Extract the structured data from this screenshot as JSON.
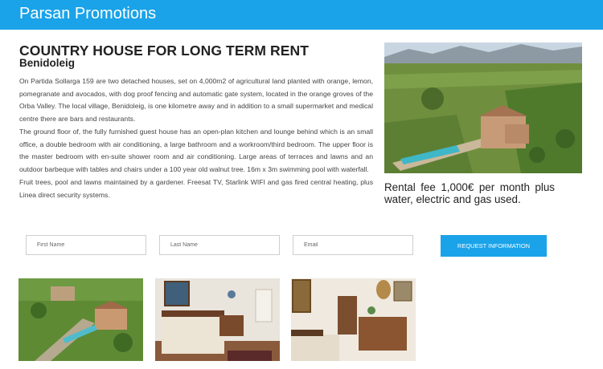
{
  "header": {
    "brand": "Parsan Promotions"
  },
  "listing": {
    "title": "COUNTRY HOUSE FOR LONG TERM RENT",
    "location": "Benidoleig",
    "paragraphs": [
      "On Partida Sollarga 159 are two detached houses, set on 4,000m2 of agricultural land planted with orange, lemon, pomegranate and avocados, with dog proof fencing and automatic gate system, located in the orange groves of the Orba Valley. The local village, Benidoleig, is one kilometre away and in addition to a small supermarket and medical centre there are bars and restaurants.",
      "The ground floor of, the fully furnished guest house has an open-plan kitchen and lounge behind which is an small office, a double bedroom with air conditioning, a large bathroom and a workroom/third bedroom. The upper floor is the master bedroom with en-suite shower room and air conditioning. Large areas of terraces and lawns and an outdoor barbeque with tables and chairs under a 100 year old walnut tree. 16m x 3m swimming pool with waterfall.",
      "Fruit trees, pool and lawns maintained by a gardener. Freesat TV, Starlink WIFI and gas fired central heating, plus Linea direct security systems."
    ],
    "rental": "Rental fee 1,000€ per month plus water, electric and gas used."
  },
  "form": {
    "first_name_placeholder": "First Name",
    "last_name_placeholder": "Last Name",
    "email_placeholder": "Email",
    "submit_label": "REQUEST INFORMATION"
  },
  "colors": {
    "accent": "#1aa3e8"
  }
}
